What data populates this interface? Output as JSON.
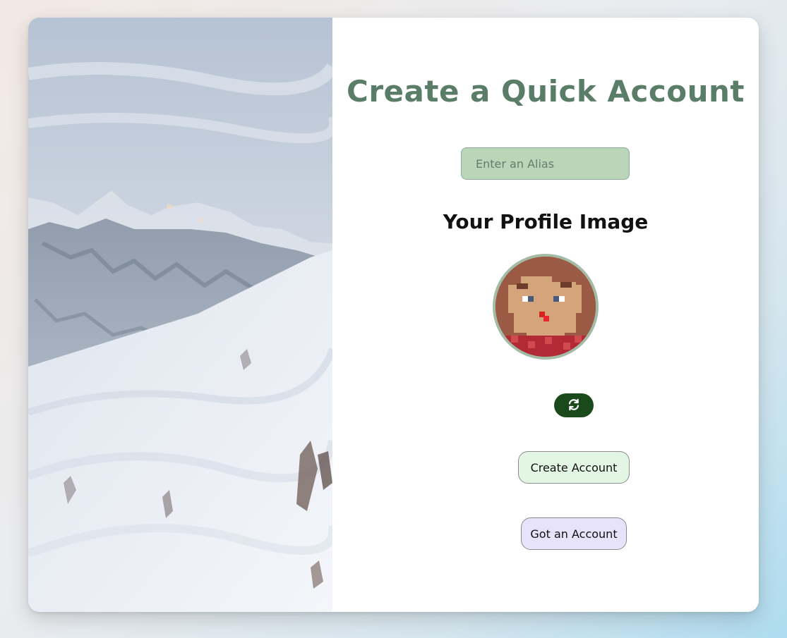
{
  "form": {
    "title": "Create a Quick Account",
    "alias_placeholder": "Enter an Alias",
    "alias_value": "",
    "profile_image_heading": "Your Profile Image",
    "create_account_label": "Create Account",
    "got_account_label": "Got an Account"
  },
  "icons": {
    "refresh": "refresh-icon"
  },
  "colors": {
    "title": "#5a7d68",
    "input_bg": "#b9d6b9",
    "refresh_bg": "#1a4a1c",
    "create_bg": "#e3f5e3",
    "login_bg": "#e6e3fb",
    "avatar_border": "#a4bba6"
  }
}
